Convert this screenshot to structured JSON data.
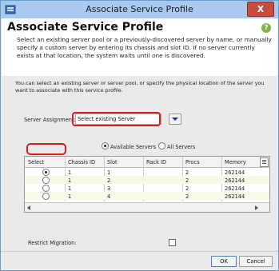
{
  "window": {
    "title": "Associate Service Profile",
    "close_label": "X"
  },
  "header": {
    "heading": "Associate Service Profile",
    "help_label": "?",
    "description": "Select an existing server pool or a previously-discovered server by name, or manually specify a custom server by entering its chassis and slot ID. If no server currently exists at that location, the system waits until one is discovered."
  },
  "intro_text": "You can select an existing server or server pool, or specify the physical location of the server you want to associate with this service profile.",
  "assignment": {
    "label": "Server Assignment:",
    "value": "Select existing Server"
  },
  "filter": {
    "options": [
      {
        "label": "Available Servers",
        "selected": true
      },
      {
        "label": "All Servers",
        "selected": false
      }
    ]
  },
  "table": {
    "columns": [
      "Select",
      "Chassis ID",
      "Slot",
      "Rack ID",
      "Procs",
      "Memory"
    ],
    "rows": [
      {
        "selected": true,
        "chassis": "1",
        "slot": "1",
        "rack": "",
        "procs": "2",
        "memory": "262144"
      },
      {
        "selected": false,
        "chassis": "1",
        "slot": "2",
        "rack": "",
        "procs": "2",
        "memory": "262144"
      },
      {
        "selected": false,
        "chassis": "1",
        "slot": "3",
        "rack": "",
        "procs": "2",
        "memory": "262144"
      },
      {
        "selected": false,
        "chassis": "1",
        "slot": "4",
        "rack": "",
        "procs": "2",
        "memory": "262144"
      }
    ]
  },
  "restrict_migration": {
    "label": "Restrict Migration:",
    "checked": false
  },
  "buttons": {
    "ok": "OK",
    "cancel": "Cancel"
  }
}
